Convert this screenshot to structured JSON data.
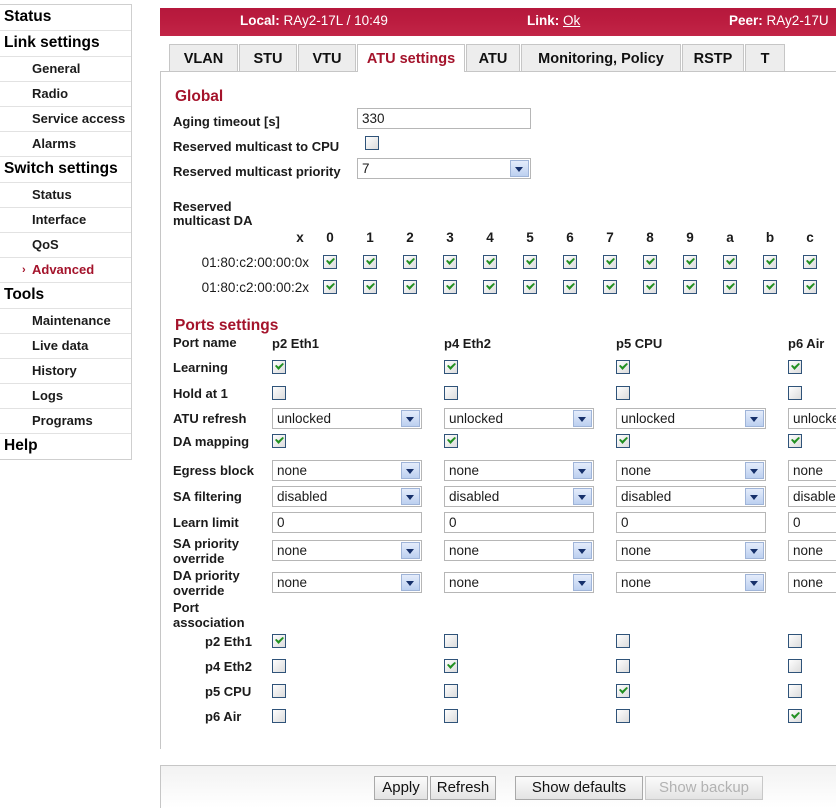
{
  "sidebar": {
    "items": [
      {
        "label": "Status",
        "type": "group",
        "active": false
      },
      {
        "label": "Link settings",
        "type": "group",
        "active": false
      },
      {
        "label": "General",
        "type": "item",
        "active": false
      },
      {
        "label": "Radio",
        "type": "item",
        "active": false
      },
      {
        "label": "Service access",
        "type": "item",
        "active": false
      },
      {
        "label": "Alarms",
        "type": "item",
        "active": false
      },
      {
        "label": "Switch settings",
        "type": "group",
        "active": true
      },
      {
        "label": "Status",
        "type": "item",
        "active": false
      },
      {
        "label": "Interface",
        "type": "item",
        "active": false
      },
      {
        "label": "QoS",
        "type": "item",
        "active": false
      },
      {
        "label": "Advanced",
        "type": "item",
        "active": true
      },
      {
        "label": "Tools",
        "type": "group",
        "active": false
      },
      {
        "label": "Maintenance",
        "type": "item",
        "active": false
      },
      {
        "label": "Live data",
        "type": "item",
        "active": false
      },
      {
        "label": "History",
        "type": "item",
        "active": false
      },
      {
        "label": "Logs",
        "type": "item",
        "active": false
      },
      {
        "label": "Programs",
        "type": "item",
        "active": false
      },
      {
        "label": "Help",
        "type": "group",
        "active": false
      }
    ]
  },
  "topbar": {
    "local_label": "Local:",
    "local_value": "RAy2-17L / 10:49",
    "link_label": "Link:",
    "link_value": "Ok",
    "peer_label": "Peer:",
    "peer_value": "RAy2-17U",
    "color": "#bb1c3f"
  },
  "tabs": [
    {
      "label": "VLAN",
      "active": false
    },
    {
      "label": "STU",
      "active": false
    },
    {
      "label": "VTU",
      "active": false
    },
    {
      "label": "ATU settings",
      "active": true
    },
    {
      "label": "ATU",
      "active": false
    },
    {
      "label": "Monitoring, Policy",
      "active": false
    },
    {
      "label": "RSTP",
      "active": false
    },
    {
      "label": "T",
      "active": false
    }
  ],
  "global": {
    "title": "Global",
    "aging_timeout_label": "Aging timeout [s]",
    "aging_timeout_value": "330",
    "reserved_multicast_cpu_label": "Reserved multicast to CPU",
    "reserved_multicast_cpu_checked": false,
    "reserved_multicast_priority_label": "Reserved multicast priority",
    "reserved_multicast_priority_value": "7",
    "reserved_multicast_da_label": "Reserved multicast DA",
    "da_columns": [
      "0",
      "1",
      "2",
      "3",
      "4",
      "5",
      "6",
      "7",
      "8",
      "9",
      "a",
      "b",
      "c"
    ],
    "da_corner": "x",
    "da_rows": [
      {
        "label": "01:80:c2:00:00:0x",
        "values": [
          true,
          true,
          true,
          true,
          true,
          true,
          true,
          true,
          true,
          true,
          true,
          true,
          true
        ]
      },
      {
        "label": "01:80:c2:00:00:2x",
        "values": [
          true,
          true,
          true,
          true,
          true,
          true,
          true,
          true,
          true,
          true,
          true,
          true,
          true
        ]
      }
    ]
  },
  "ports": {
    "title": "Ports settings",
    "row_labels": {
      "port_name": "Port name",
      "learning": "Learning",
      "hold_at_1": "Hold at 1",
      "atu_refresh": "ATU refresh",
      "da_mapping": "DA mapping",
      "egress_block": "Egress block",
      "sa_filtering": "SA filtering",
      "learn_limit": "Learn limit",
      "sa_priority_override": "SA priority override",
      "da_priority_override": "DA priority override",
      "port_association": "Port association"
    },
    "columns": [
      {
        "port_name": "p2 Eth1",
        "learning": true,
        "hold_at_1": false,
        "atu_refresh": "unlocked",
        "da_mapping": true,
        "egress_block": "none",
        "sa_filtering": "disabled",
        "learn_limit": "0",
        "sa_priority_override": "none",
        "da_priority_override": "none",
        "association": [
          true,
          false,
          false,
          false
        ]
      },
      {
        "port_name": "p4 Eth2",
        "learning": true,
        "hold_at_1": false,
        "atu_refresh": "unlocked",
        "da_mapping": true,
        "egress_block": "none",
        "sa_filtering": "disabled",
        "learn_limit": "0",
        "sa_priority_override": "none",
        "da_priority_override": "none",
        "association": [
          false,
          true,
          false,
          false
        ]
      },
      {
        "port_name": "p5 CPU",
        "learning": true,
        "hold_at_1": false,
        "atu_refresh": "unlocked",
        "da_mapping": true,
        "egress_block": "none",
        "sa_filtering": "disabled",
        "learn_limit": "0",
        "sa_priority_override": "none",
        "da_priority_override": "none",
        "association": [
          false,
          false,
          true,
          false
        ]
      },
      {
        "port_name": "p6 Air",
        "learning": true,
        "hold_at_1": false,
        "atu_refresh": "unlocked",
        "da_mapping": true,
        "egress_block": "none",
        "sa_filtering": "disabled",
        "learn_limit": "0",
        "sa_priority_override": "none",
        "da_priority_override": "none",
        "association": [
          false,
          false,
          false,
          true
        ]
      }
    ],
    "association_labels": [
      "p2 Eth1",
      "p4 Eth2",
      "p5 CPU",
      "p6 Air"
    ]
  },
  "buttons": [
    {
      "label": "Apply",
      "disabled": false
    },
    {
      "label": "Refresh",
      "disabled": false
    },
    {
      "label": "Show defaults",
      "disabled": false
    },
    {
      "label": "Show backup",
      "disabled": true
    }
  ]
}
